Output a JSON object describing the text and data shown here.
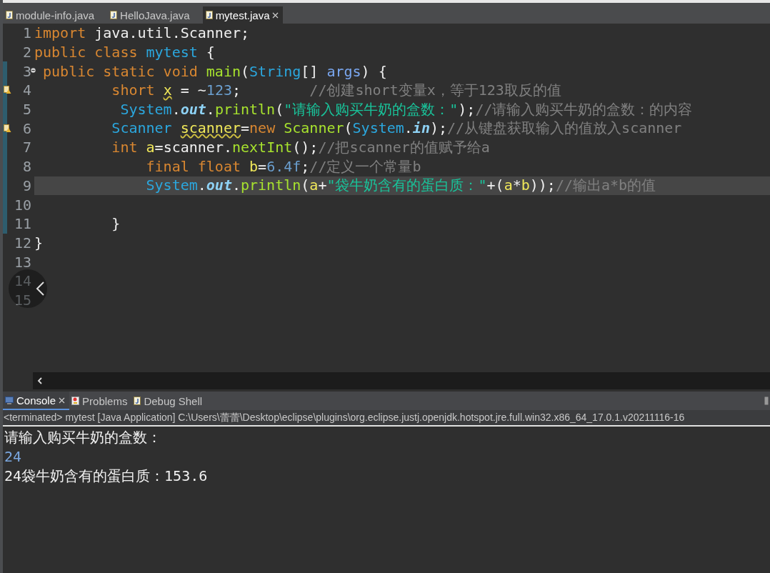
{
  "editor_tabs": [
    {
      "label": "module-info.java",
      "selected": false
    },
    {
      "label": "HelloJava.java",
      "selected": false
    },
    {
      "label": "mytest.java",
      "selected": true
    }
  ],
  "code_lines": [
    {
      "number": "1",
      "warning": false,
      "current": false,
      "fold": false,
      "changed": false,
      "tokens": [
        {
          "kind": "keyword",
          "text": "import"
        },
        {
          "kind": "plain",
          "text": " java.util.Scanner;"
        }
      ]
    },
    {
      "number": "2",
      "warning": false,
      "current": false,
      "fold": false,
      "changed": false,
      "tokens": [
        {
          "kind": "keyword",
          "text": "public class"
        },
        {
          "kind": "type",
          "text": " mytest"
        },
        {
          "kind": "plain",
          "text": " {"
        }
      ]
    },
    {
      "number": "3",
      "warning": false,
      "current": false,
      "fold": true,
      "changed": true,
      "tokens": [
        {
          "kind": "keyword",
          "text": " public static void"
        },
        {
          "kind": "method",
          "text": " main"
        },
        {
          "kind": "plain",
          "text": "("
        },
        {
          "kind": "type",
          "text": "String"
        },
        {
          "kind": "plain",
          "text": "[] "
        },
        {
          "kind": "param",
          "text": "args"
        },
        {
          "kind": "plain",
          "text": ") {"
        }
      ]
    },
    {
      "number": "4",
      "warning": true,
      "current": false,
      "fold": false,
      "changed": true,
      "tokens": [
        {
          "kind": "keyword",
          "text": "         short "
        },
        {
          "kind": "warned_variable",
          "text": "x"
        },
        {
          "kind": "plain",
          "text": " = ~"
        },
        {
          "kind": "number",
          "text": "123"
        },
        {
          "kind": "plain",
          "text": ";        "
        },
        {
          "kind": "comment",
          "text": "//创建short变量x，等于123取反的值"
        }
      ]
    },
    {
      "number": "5",
      "warning": false,
      "current": false,
      "fold": false,
      "changed": true,
      "tokens": [
        {
          "kind": "type",
          "text": "          System"
        },
        {
          "kind": "plain",
          "text": "."
        },
        {
          "kind": "field",
          "text": "out"
        },
        {
          "kind": "plain",
          "text": "."
        },
        {
          "kind": "method",
          "text": "println"
        },
        {
          "kind": "plain",
          "text": "("
        },
        {
          "kind": "string",
          "text": "\"请输入购买牛奶的盒数：\""
        },
        {
          "kind": "plain",
          "text": ");"
        },
        {
          "kind": "comment",
          "text": "//请输入购买牛奶的盒数：的内容"
        }
      ]
    },
    {
      "number": "6",
      "warning": true,
      "current": false,
      "fold": false,
      "changed": true,
      "tokens": [
        {
          "kind": "type",
          "text": "         Scanner "
        },
        {
          "kind": "warned_variable",
          "text": "scanner"
        },
        {
          "kind": "plain",
          "text": "="
        },
        {
          "kind": "keyword",
          "text": "new"
        },
        {
          "kind": "method",
          "text": " Scanner"
        },
        {
          "kind": "plain",
          "text": "("
        },
        {
          "kind": "type",
          "text": "System"
        },
        {
          "kind": "plain",
          "text": "."
        },
        {
          "kind": "field",
          "text": "in"
        },
        {
          "kind": "plain",
          "text": ");"
        },
        {
          "kind": "comment",
          "text": "//从键盘获取输入的值放入scanner"
        }
      ]
    },
    {
      "number": "7",
      "warning": false,
      "current": false,
      "fold": false,
      "changed": true,
      "tokens": [
        {
          "kind": "keyword",
          "text": "         int "
        },
        {
          "kind": "variable",
          "text": "a"
        },
        {
          "kind": "plain",
          "text": "=scanner."
        },
        {
          "kind": "method",
          "text": "nextInt"
        },
        {
          "kind": "plain",
          "text": "();"
        },
        {
          "kind": "comment",
          "text": "//把scanner的值赋予给a"
        }
      ]
    },
    {
      "number": "8",
      "warning": false,
      "current": false,
      "fold": false,
      "changed": true,
      "tokens": [
        {
          "kind": "keyword",
          "text": "             final float "
        },
        {
          "kind": "variable",
          "text": "b"
        },
        {
          "kind": "plain",
          "text": "="
        },
        {
          "kind": "number",
          "text": "6.4f"
        },
        {
          "kind": "plain",
          "text": ";"
        },
        {
          "kind": "comment",
          "text": "//定义一个常量b"
        }
      ]
    },
    {
      "number": "9",
      "warning": false,
      "current": true,
      "fold": false,
      "changed": true,
      "tokens": [
        {
          "kind": "type",
          "text": "             System"
        },
        {
          "kind": "plain",
          "text": "."
        },
        {
          "kind": "field",
          "text": "out"
        },
        {
          "kind": "plain",
          "text": "."
        },
        {
          "kind": "method",
          "text": "println"
        },
        {
          "kind": "plain",
          "text": "("
        },
        {
          "kind": "variable",
          "text": "a"
        },
        {
          "kind": "plain",
          "text": "+"
        },
        {
          "kind": "string",
          "text": "\"袋牛奶含有的蛋白质：\""
        },
        {
          "kind": "plain",
          "text": "+("
        },
        {
          "kind": "variable",
          "text": "a"
        },
        {
          "kind": "plain",
          "text": "*"
        },
        {
          "kind": "variable",
          "text": "b"
        },
        {
          "kind": "plain",
          "text": "));"
        },
        {
          "kind": "comment",
          "text": "//输出a*b的值"
        }
      ]
    },
    {
      "number": "10",
      "warning": false,
      "current": false,
      "fold": false,
      "changed": true
    },
    {
      "number": "11",
      "warning": false,
      "current": false,
      "fold": false,
      "changed": true,
      "tokens": [
        {
          "kind": "plain",
          "text": "         }"
        }
      ]
    },
    {
      "number": "12",
      "warning": false,
      "current": false,
      "fold": false,
      "changed": false,
      "tokens": [
        {
          "kind": "plain",
          "text": "}"
        }
      ]
    },
    {
      "number": "13",
      "warning": false,
      "current": false,
      "fold": false,
      "changed": false
    },
    {
      "number": "14",
      "warning": false,
      "current": false,
      "fold": false,
      "changed": false
    },
    {
      "number": "15",
      "warning": false,
      "current": false,
      "fold": false,
      "changed": false
    }
  ],
  "console_tabs": [
    {
      "label": "Console",
      "selected": true,
      "kind": "console"
    },
    {
      "label": "Problems",
      "selected": false,
      "kind": "problems"
    },
    {
      "label": "Debug Shell",
      "selected": false,
      "kind": "debug"
    }
  ],
  "console_status": "<terminated> mytest [Java Application] C:\\Users\\蕾蕾\\Desktop\\eclipse\\plugins\\org.eclipse.justj.openjdk.hotspot.jre.full.win32.x86_64_17.0.1.v20211116-16",
  "console_output": [
    {
      "kind": "output",
      "text": "请输入购买牛奶的盒数："
    },
    {
      "kind": "input",
      "text": "24"
    },
    {
      "kind": "output",
      "text": "24袋牛奶含有的蛋白质：153.6"
    }
  ]
}
